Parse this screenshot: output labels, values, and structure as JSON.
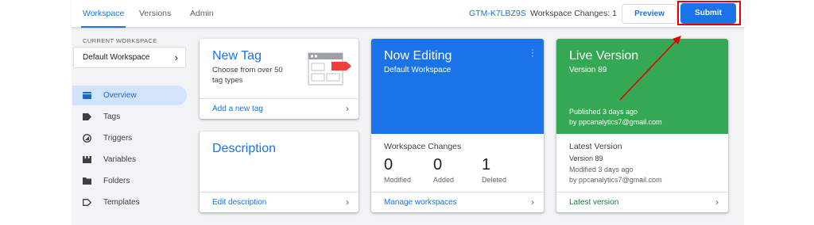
{
  "topbar": {
    "tabs": [
      {
        "label": "Workspace",
        "active": true
      },
      {
        "label": "Versions",
        "active": false
      },
      {
        "label": "Admin",
        "active": false
      }
    ],
    "container_id": "GTM-K7LBZ9S",
    "workspace_changes": "Workspace Changes: 1",
    "preview_label": "Preview",
    "submit_label": "Submit"
  },
  "sidebar": {
    "current_workspace_label": "CURRENT WORKSPACE",
    "current_workspace_name": "Default Workspace",
    "items": [
      {
        "label": "Overview",
        "icon": "overview-icon",
        "active": true
      },
      {
        "label": "Tags",
        "icon": "tag-icon",
        "active": false
      },
      {
        "label": "Triggers",
        "icon": "trigger-icon",
        "active": false
      },
      {
        "label": "Variables",
        "icon": "variables-icon",
        "active": false
      },
      {
        "label": "Folders",
        "icon": "folder-icon",
        "active": false
      },
      {
        "label": "Templates",
        "icon": "template-icon",
        "active": false
      }
    ]
  },
  "cards": {
    "new_tag": {
      "title": "New Tag",
      "subtitle": "Choose from over 50 tag types",
      "link": "Add a new tag"
    },
    "description": {
      "title": "Description",
      "link": "Edit description"
    },
    "now_editing": {
      "title": "Now Editing",
      "subtitle": "Default Workspace",
      "changes_title": "Workspace Changes",
      "stats": [
        {
          "value": "0",
          "label": "Modified"
        },
        {
          "value": "0",
          "label": "Added"
        },
        {
          "value": "1",
          "label": "Deleted"
        }
      ],
      "link": "Manage workspaces"
    },
    "live_version": {
      "title": "Live Version",
      "version": "Version 89",
      "published": "Published 3 days ago",
      "published_by": "by ppcanalytics7@gmail.com",
      "latest_title": "Latest Version",
      "latest_version": "Version 89",
      "latest_modified": "Modified 3 days ago",
      "latest_by": "by ppcanalytics7@gmail.com",
      "link": "Latest version"
    }
  },
  "colors": {
    "primary": "#1a73e8",
    "live_green": "#34a853",
    "annotation_red": "#e60000"
  }
}
